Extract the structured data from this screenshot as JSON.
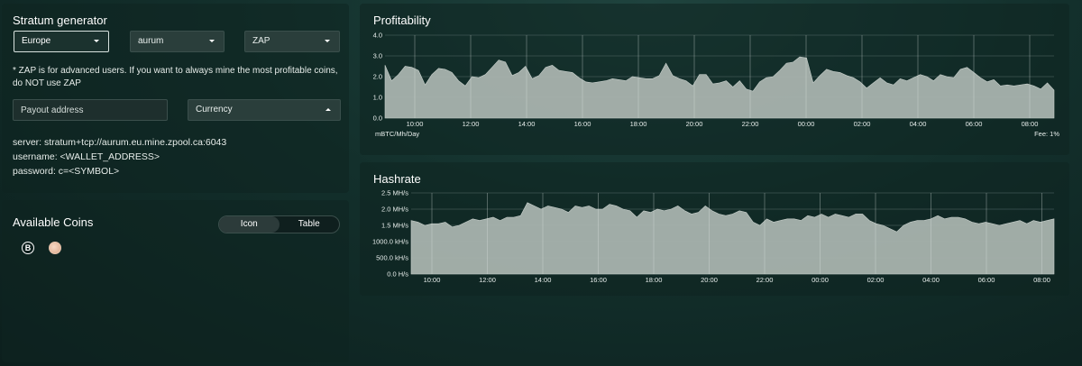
{
  "stratum": {
    "title": "Stratum generator",
    "region": "Europe",
    "algo": "aurum",
    "coin": "ZAP",
    "zap_note": "* ZAP is for advanced users. If you want to always mine the most profitable coins, do NOT use ZAP",
    "payout_placeholder": "Payout address",
    "currency": "Currency",
    "server_line": "server: stratum+tcp://aurum.eu.mine.zpool.ca:6043",
    "username_line": "username: <WALLET_ADDRESS>",
    "password_line": "password: c=<SYMBOL>"
  },
  "coins": {
    "title": "Available Coins",
    "toggle_icon": "Icon",
    "toggle_table": "Table",
    "items": [
      {
        "name": "bitcoin-icon",
        "glyph": "B"
      },
      {
        "name": "peach-coin-icon",
        "glyph": "~"
      }
    ]
  },
  "profitability": {
    "title": "Profitability",
    "unit_label": "mBTC/Mh/Day",
    "fee_label": "Fee: 1%",
    "y_ticks": [
      "4.0",
      "3.0",
      "2.0",
      "1.0",
      "0.0"
    ],
    "x_ticks": [
      "10:00",
      "12:00",
      "14:00",
      "16:00",
      "18:00",
      "20:00",
      "22:00",
      "00:00",
      "02:00",
      "04:00",
      "06:00",
      "08:00"
    ],
    "fill_color": "#a9b3ae"
  },
  "hashrate": {
    "title": "Hashrate",
    "y_ticks": [
      "2.5 MH/s",
      "2.0 MH/s",
      "1.5 MH/s",
      "1000.0 kH/s",
      "500.0 kH/s",
      "0.0 H/s"
    ],
    "x_ticks": [
      "10:00",
      "12:00",
      "14:00",
      "16:00",
      "18:00",
      "20:00",
      "22:00",
      "00:00",
      "02:00",
      "04:00",
      "06:00",
      "08:00"
    ],
    "fill_color": "#a9b3ae"
  },
  "chart_data": [
    {
      "type": "area",
      "title": "Profitability",
      "xlabel": "",
      "ylabel": "mBTC/Mh/Day",
      "ylim": [
        0,
        4
      ],
      "grid": true,
      "x_ticks": [
        "10:00",
        "12:00",
        "14:00",
        "16:00",
        "18:00",
        "20:00",
        "22:00",
        "00:00",
        "02:00",
        "04:00",
        "06:00",
        "08:00"
      ],
      "values": [
        2.55,
        1.8,
        2.1,
        2.5,
        2.45,
        2.3,
        1.6,
        2.1,
        2.4,
        2.35,
        2.2,
        1.8,
        1.55,
        2.0,
        1.95,
        2.1,
        2.45,
        2.8,
        2.7,
        2.05,
        2.2,
        2.5,
        1.9,
        2.05,
        2.45,
        2.55,
        2.3,
        2.25,
        2.2,
        1.95,
        1.75,
        1.7,
        1.75,
        1.8,
        1.9,
        1.85,
        1.8,
        2.0,
        1.95,
        1.9,
        1.9,
        2.05,
        2.65,
        2.05,
        1.9,
        1.8,
        1.55,
        2.1,
        2.1,
        1.65,
        1.7,
        1.8,
        1.5,
        1.8,
        1.4,
        1.3,
        1.75,
        1.95,
        2.0,
        2.3,
        2.65,
        2.7,
        2.95,
        2.9,
        1.7,
        2.05,
        2.35,
        2.25,
        2.2,
        2.05,
        1.95,
        1.75,
        1.45,
        1.7,
        1.95,
        1.7,
        1.6,
        1.9,
        1.8,
        1.95,
        2.1,
        2.0,
        1.8,
        2.1,
        2.0,
        1.95,
        2.35,
        2.45,
        2.2,
        1.95,
        1.75,
        1.85,
        1.55,
        1.6,
        1.55,
        1.6,
        1.65,
        1.55,
        1.4,
        1.7,
        1.35
      ]
    },
    {
      "type": "area",
      "title": "Hashrate",
      "xlabel": "",
      "ylabel": "",
      "ylim": [
        0,
        2.5
      ],
      "grid": true,
      "x_ticks": [
        "10:00",
        "12:00",
        "14:00",
        "16:00",
        "18:00",
        "20:00",
        "22:00",
        "00:00",
        "02:00",
        "04:00",
        "06:00",
        "08:00"
      ],
      "values": [
        1.65,
        1.6,
        1.5,
        1.55,
        1.55,
        1.6,
        1.45,
        1.5,
        1.6,
        1.7,
        1.65,
        1.7,
        1.75,
        1.65,
        1.75,
        1.75,
        1.8,
        2.2,
        2.1,
        2.0,
        2.1,
        2.05,
        2.0,
        1.9,
        2.1,
        2.05,
        2.1,
        2.0,
        2.0,
        2.15,
        2.1,
        2.0,
        1.95,
        1.75,
        1.95,
        1.9,
        2.0,
        1.95,
        2.0,
        2.1,
        1.95,
        1.85,
        1.9,
        2.1,
        1.95,
        1.85,
        1.8,
        1.85,
        1.95,
        1.9,
        1.6,
        1.5,
        1.7,
        1.6,
        1.65,
        1.7,
        1.7,
        1.65,
        1.8,
        1.75,
        1.85,
        1.75,
        1.85,
        1.8,
        1.75,
        1.85,
        1.85,
        1.65,
        1.55,
        1.5,
        1.4,
        1.3,
        1.5,
        1.6,
        1.65,
        1.65,
        1.7,
        1.8,
        1.7,
        1.75,
        1.75,
        1.7,
        1.6,
        1.55,
        1.6,
        1.55,
        1.5,
        1.55,
        1.6,
        1.65,
        1.55,
        1.65,
        1.6,
        1.65,
        1.7
      ]
    }
  ]
}
